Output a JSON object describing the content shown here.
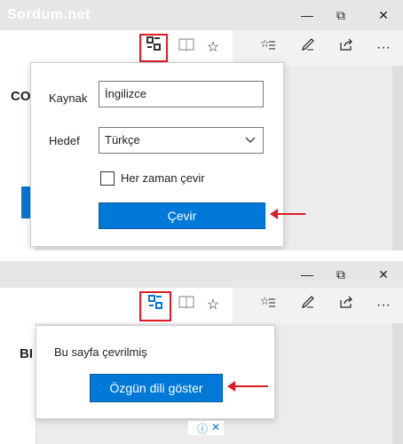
{
  "panel1": {
    "watermark": "Sordum.net",
    "window_controls": {
      "minimize": "—",
      "restore": "⧉",
      "close": "✕"
    },
    "toolbar_icons": [
      "translate-icon",
      "reading-view-icon",
      "favorite-star-icon",
      "favorites-list-icon",
      "pen-notes-icon",
      "share-icon",
      "more-icon"
    ],
    "page_partial_text": "CO",
    "translate_flyout": {
      "source_label": "Kaynak",
      "source_value": "İngilizce",
      "target_label": "Hedef",
      "target_value": "Türkçe",
      "checkbox_label": "Her zaman çevir",
      "checkbox_checked": false,
      "translate_button": "Çevir"
    }
  },
  "panel2": {
    "toolbar_icons": [
      "translate-icon",
      "reading-view-icon",
      "favorite-star-icon",
      "favorites-list-icon",
      "pen-notes-icon",
      "share-icon",
      "more-icon"
    ],
    "page_partial_text": "BI",
    "translated_flyout": {
      "message": "Bu sayfa çevrilmiş",
      "show_original_button": "Özgün dili göster"
    },
    "ad_icons": [
      "info-icon",
      "close-icon"
    ]
  },
  "colors": {
    "accent": "#0078d7",
    "highlight": "#e01b24"
  }
}
